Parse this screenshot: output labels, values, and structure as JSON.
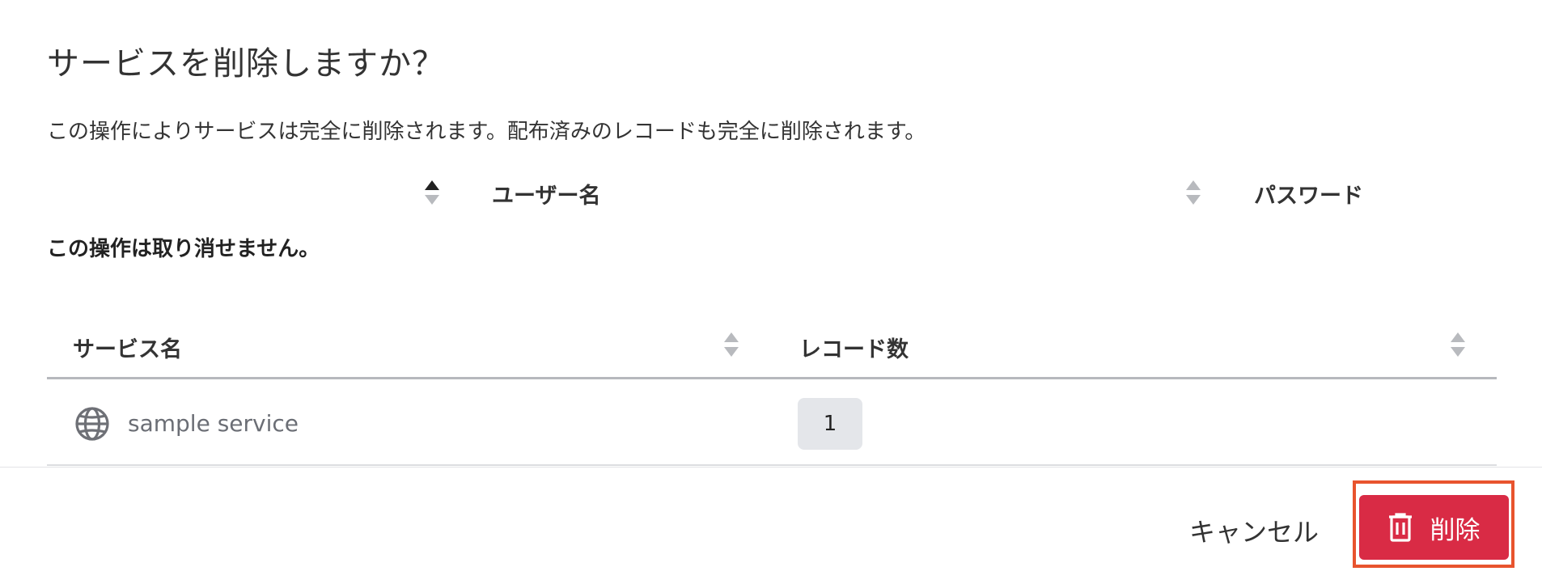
{
  "dialog": {
    "title": "サービスを削除しますか？",
    "description": "この操作によりサービスは完全に削除されます。配布済みのレコードも完全に削除されます。",
    "warning": "この操作は取り消せません。"
  },
  "background_table": {
    "columns": [
      {
        "label": "ユーザー名",
        "sort": "ascending"
      },
      {
        "label": "パスワード",
        "sort": "none"
      }
    ]
  },
  "services_table": {
    "columns": [
      {
        "label": "サービス名",
        "sort_icon": "sort-arrows-icon"
      },
      {
        "label": "レコード数",
        "sort_icon": "sort-arrows-icon"
      }
    ],
    "rows": [
      {
        "icon": "globe-icon",
        "service_name": "sample service",
        "record_count": "1"
      }
    ]
  },
  "footer": {
    "cancel_label": "キャンセル",
    "delete_label": "削除",
    "delete_icon": "trash-icon"
  },
  "colors": {
    "danger": "#d92b45",
    "highlight": "#e8542e",
    "badge_bg": "#e4e6ea",
    "header_rule": "#b6b8bd"
  }
}
